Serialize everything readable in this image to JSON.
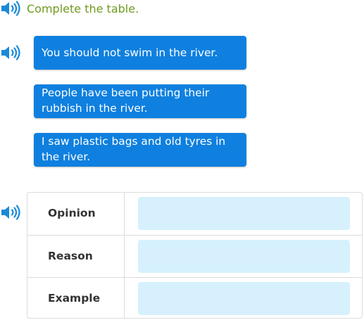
{
  "instruction": {
    "text": "Complete the table.",
    "color": "#6f9a1f"
  },
  "icons": {
    "speaker": "speaker-icon",
    "color": "#1a8ad8"
  },
  "tiles": [
    {
      "text": "You should not swim in the river."
    },
    {
      "text": "People have been putting their rubbish in the river."
    },
    {
      "text": "I saw plastic bags and old tyres in the river."
    }
  ],
  "tile_color": "#0f80df",
  "table": {
    "rows": [
      {
        "label": "Opinion",
        "answer": ""
      },
      {
        "label": "Reason",
        "answer": ""
      },
      {
        "label": "Example",
        "answer": ""
      }
    ],
    "drop_zone_color": "#d6f1fd"
  }
}
